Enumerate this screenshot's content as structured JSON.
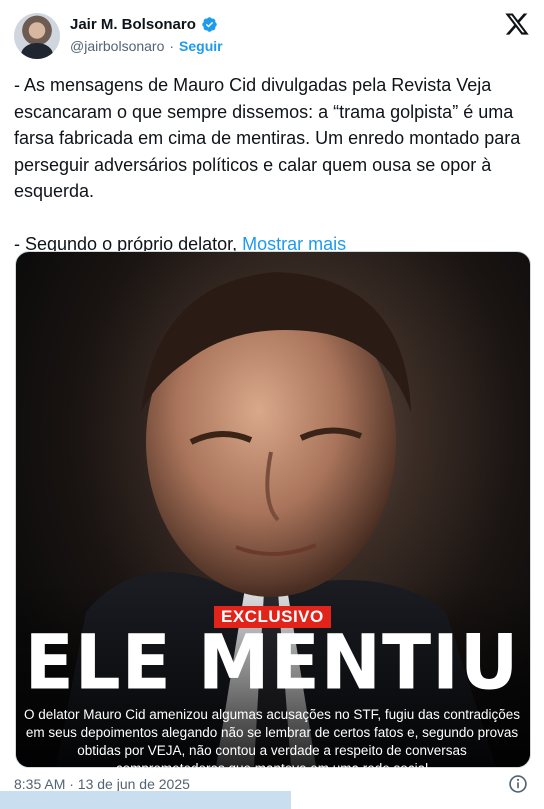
{
  "header": {
    "name": "Jair M. Bolsonaro",
    "handle": "@jairbolsonaro",
    "separator": "·",
    "follow_label": "Seguir"
  },
  "tweet": {
    "text": "- As mensagens de Mauro Cid divulgadas pela Revista Veja escancaram o que sempre dissemos: a “trama golpista” é uma farsa fabricada em cima de mentiras. Um enredo montado para perseguir adversários políticos e calar quem ousa se opor à esquerda.\n\n- Segundo o próprio delator, ",
    "show_more": "Mostrar mais"
  },
  "media": {
    "badge": "EXCLUSIVO",
    "headline": "ELE MENTIU",
    "caption": "O delator Mauro Cid amenizou algumas acusações no STF, fugiu das contradições em seus depoimentos alegando não se lembrar de certos fatos e, segundo provas obtidas por VEJA, não contou a verdade a respeito de conversas comprometedoras que manteve em uma rede social"
  },
  "footer": {
    "timestamp": "8:35 AM · 13 de jun de 2025"
  },
  "colors": {
    "accent": "#1d9bf0",
    "text": "#0f1419",
    "muted": "#536471",
    "badge_red": "#e2231a"
  },
  "icons": {
    "verified": "verified-badge-icon",
    "brand": "x-logo-icon",
    "info": "info-icon"
  }
}
